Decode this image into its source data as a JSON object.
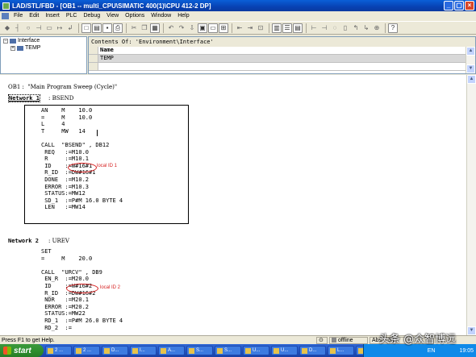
{
  "window": {
    "title": "LAD/STL/FBD  - [OB1 -- multi_CPU\\SIMATIC 400(1)\\CPU 412-2 DP]",
    "min": "_",
    "max": "▢",
    "close": "×"
  },
  "menu": [
    "File",
    "Edit",
    "Insert",
    "PLC",
    "Debug",
    "View",
    "Options",
    "Window",
    "Help"
  ],
  "interface_panel": {
    "root": "Interface",
    "child": "TEMP"
  },
  "contents": {
    "header": "Contents Of: 'Environment\\Interface'",
    "col_name": "Name",
    "row1": "TEMP"
  },
  "editor": {
    "ob_title": "OB1 :  \"Main Program Sweep (Cycle)\"",
    "net1_label": "Network 1",
    "net1_title": ": BSEND",
    "net1_lines": [
      "AN    M    10.0",
      "=     M    10.0",
      "L     4",
      "T     MW   14",
      "",
      "CALL  \"BSEND\" , DB12",
      " REQ   :=M10.0",
      " R     :=M10.1",
      " ID    :=W#16#1",
      " R_ID  :=DW#16#1",
      " DONE  :=M10.2",
      " ERROR :=M10.3",
      " STATUS:=MW12",
      " SD_1  :=P#M 16.0 BYTE 4",
      " LEN   :=MW14"
    ],
    "note1": "local ID 1",
    "net2_label": "Network 2",
    "net2_title": ": UREV",
    "net2_lines": [
      "SET",
      "=     M    20.0",
      "",
      "CALL  \"URCV\" , DB9",
      " EN_R  :=M20.0",
      " ID    :=W#16#2",
      " R_ID  :=DW#16#2",
      " NDR   :=M20.1",
      " ERROR :=M20.2",
      " STATUS:=MW22",
      " RD_1  :=P#M 26.0 BYTE 4",
      " RD_2  :="
    ],
    "note2": "local ID 2"
  },
  "status": {
    "help": "Press F1 to get Help.",
    "mode": "offline",
    "abs": "Abs < 5.2"
  },
  "taskbar": {
    "start": "start",
    "tasks": [
      "2 ...",
      "2 ...",
      "D...",
      "I...",
      "A...",
      "S...",
      "S...",
      "U...",
      "U...",
      "D...",
      "L...",
      "M...",
      "L..."
    ],
    "lang": "EN",
    "clock": "19:05"
  },
  "watermark": "头条 @众智博远"
}
